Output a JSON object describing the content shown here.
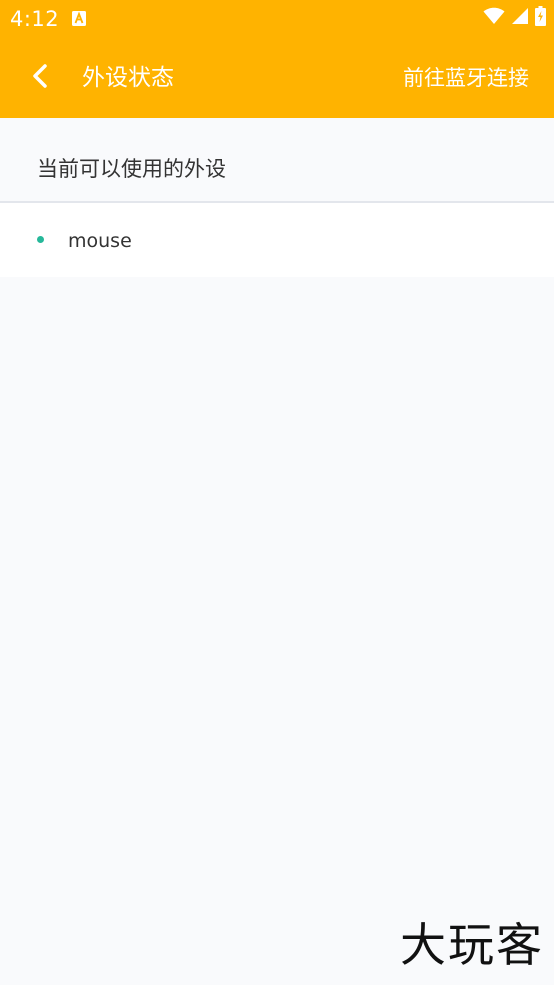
{
  "status_bar": {
    "time": "4:12",
    "notification_icon": "a-letter-icon",
    "icons": [
      "wifi-icon",
      "cell-signal-icon",
      "battery-charging-icon"
    ]
  },
  "app_bar": {
    "back_icon": "chevron-left-icon",
    "title": "外设状态",
    "action_label": "前往蓝牙连接",
    "background_color": "#ffb300"
  },
  "section": {
    "title": "当前可以使用的外设"
  },
  "devices": [
    {
      "name": "mouse",
      "status_color": "#26b89a"
    }
  ],
  "watermark": {
    "text": "大玩客"
  }
}
